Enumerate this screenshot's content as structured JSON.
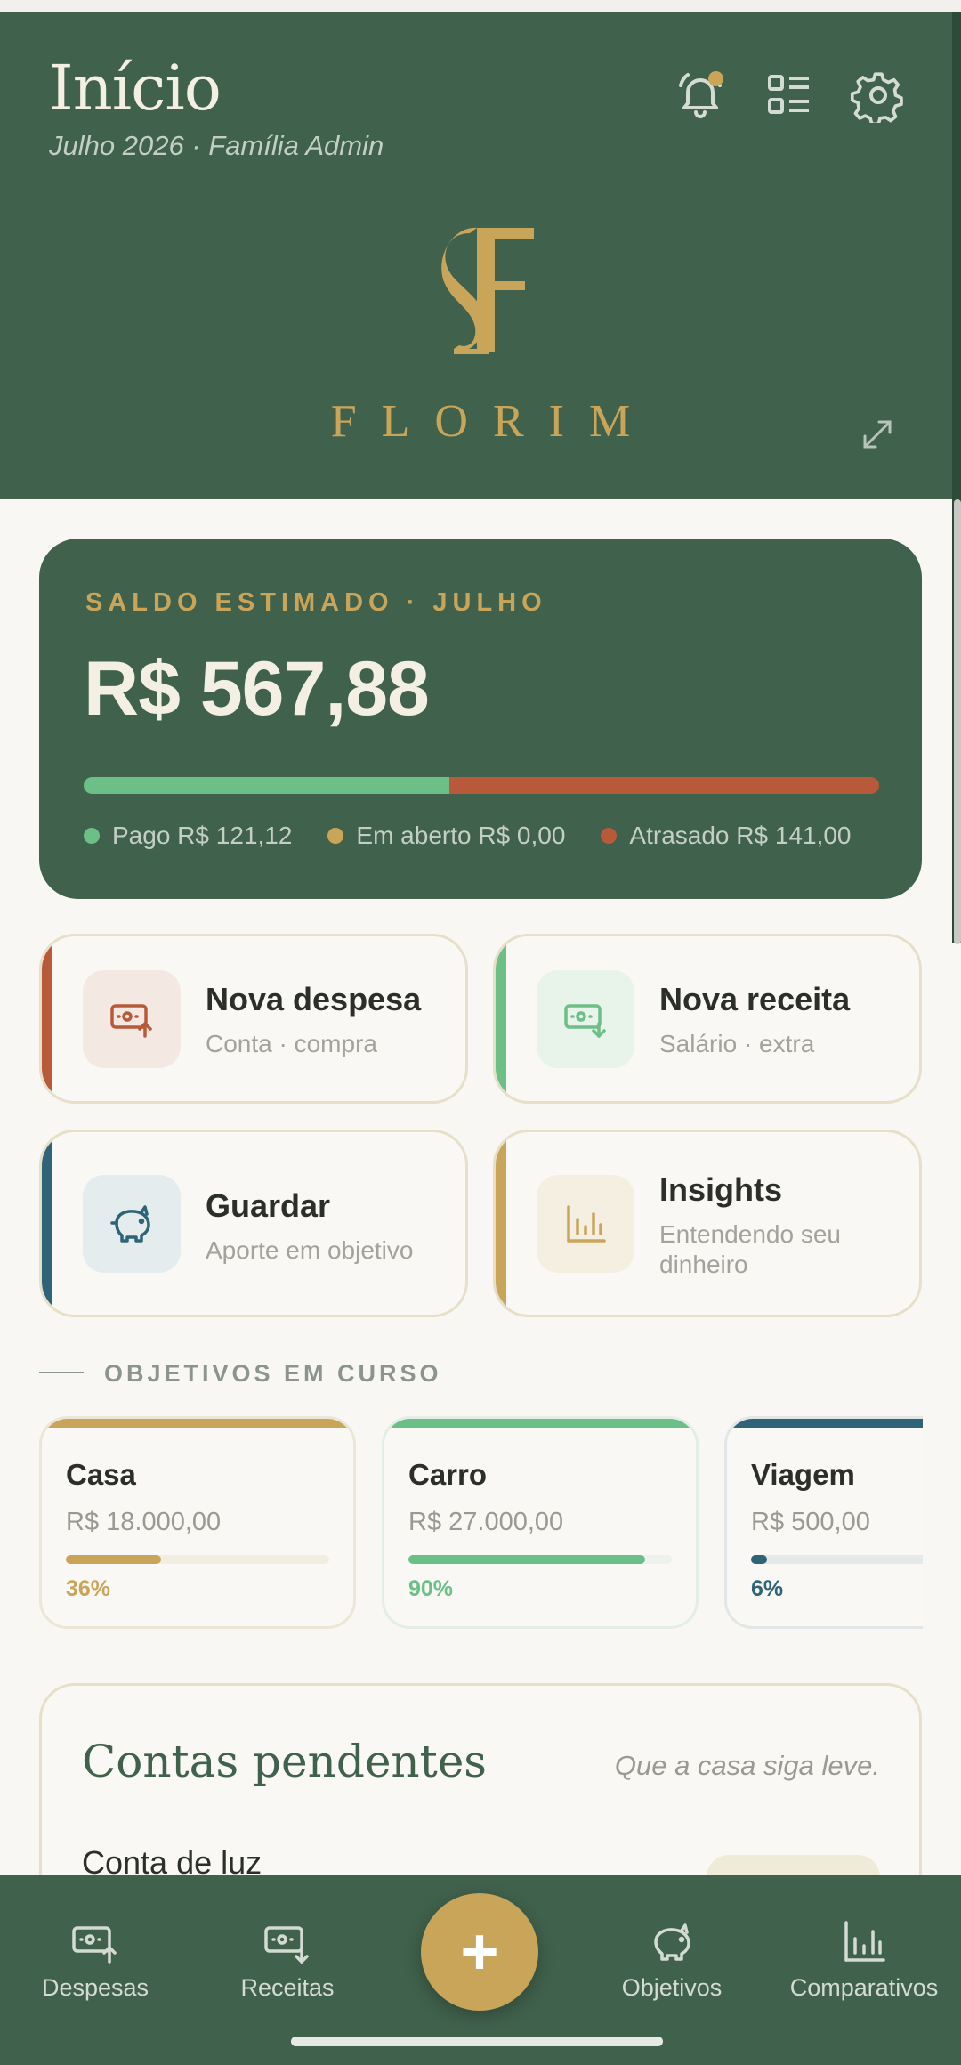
{
  "header": {
    "title": "Início",
    "subtitle": "Julho 2026 · Família Admin",
    "brand": "FLORIM",
    "icons": [
      "bell-icon",
      "list-icon",
      "gear-icon",
      "expand-icon"
    ],
    "has_notification": true
  },
  "balance": {
    "label": "SALDO ESTIMADO · JULHO",
    "value": "R$ 567,88",
    "paid_fraction": 0.46,
    "legend": [
      {
        "label": "Pago R$ 121,12",
        "color": "#6cbf87"
      },
      {
        "label": "Em aberto R$ 0,00",
        "color": "#c9a55a"
      },
      {
        "label": "Atrasado R$ 141,00",
        "color": "#b85a3a"
      }
    ]
  },
  "actions": [
    {
      "title": "Nova despesa",
      "subtitle": "Conta · compra",
      "color": "#b85a3a",
      "icon": "money-out-icon"
    },
    {
      "title": "Nova receita",
      "subtitle": "Salário · extra",
      "color": "#6cbf87",
      "icon": "money-in-icon"
    },
    {
      "title": "Guardar",
      "subtitle": "Aporte em objetivo",
      "color": "#2e6378",
      "icon": "piggy-bank-icon"
    },
    {
      "title": "Insights",
      "subtitle": "Entendendo seu dinheiro",
      "color": "#c9a55a",
      "icon": "bar-chart-icon"
    }
  ],
  "goals_section": {
    "title": "OBJETIVOS EM CURSO"
  },
  "goals": [
    {
      "name": "Casa",
      "value": "R$ 18.000,00",
      "percent_label": "36%",
      "fraction": 0.36,
      "color": "#c9a55a"
    },
    {
      "name": "Carro",
      "value": "R$ 27.000,00",
      "percent_label": "90%",
      "fraction": 0.9,
      "color": "#6cbf87"
    },
    {
      "name": "Viagem",
      "value": "R$ 500,00",
      "percent_label": "6%",
      "fraction": 0.06,
      "color": "#2e6378"
    }
  ],
  "bills": {
    "title": "Contas pendentes",
    "note": "Que a casa siga leve.",
    "items": [
      {
        "name": "Conta de luz"
      }
    ]
  },
  "nav": {
    "items": [
      {
        "label": "Despesas",
        "icon": "money-out-icon"
      },
      {
        "label": "Receitas",
        "icon": "money-in-icon"
      },
      {
        "label": "Objetivos",
        "icon": "piggy-bank-icon"
      },
      {
        "label": "Comparativos",
        "icon": "bar-chart-icon"
      }
    ],
    "fab_label": "+"
  },
  "colors": {
    "primary": "#40614c",
    "gold": "#c9a55a",
    "paid": "#6cbf87",
    "late": "#b85a3a",
    "teal": "#2e6378"
  }
}
